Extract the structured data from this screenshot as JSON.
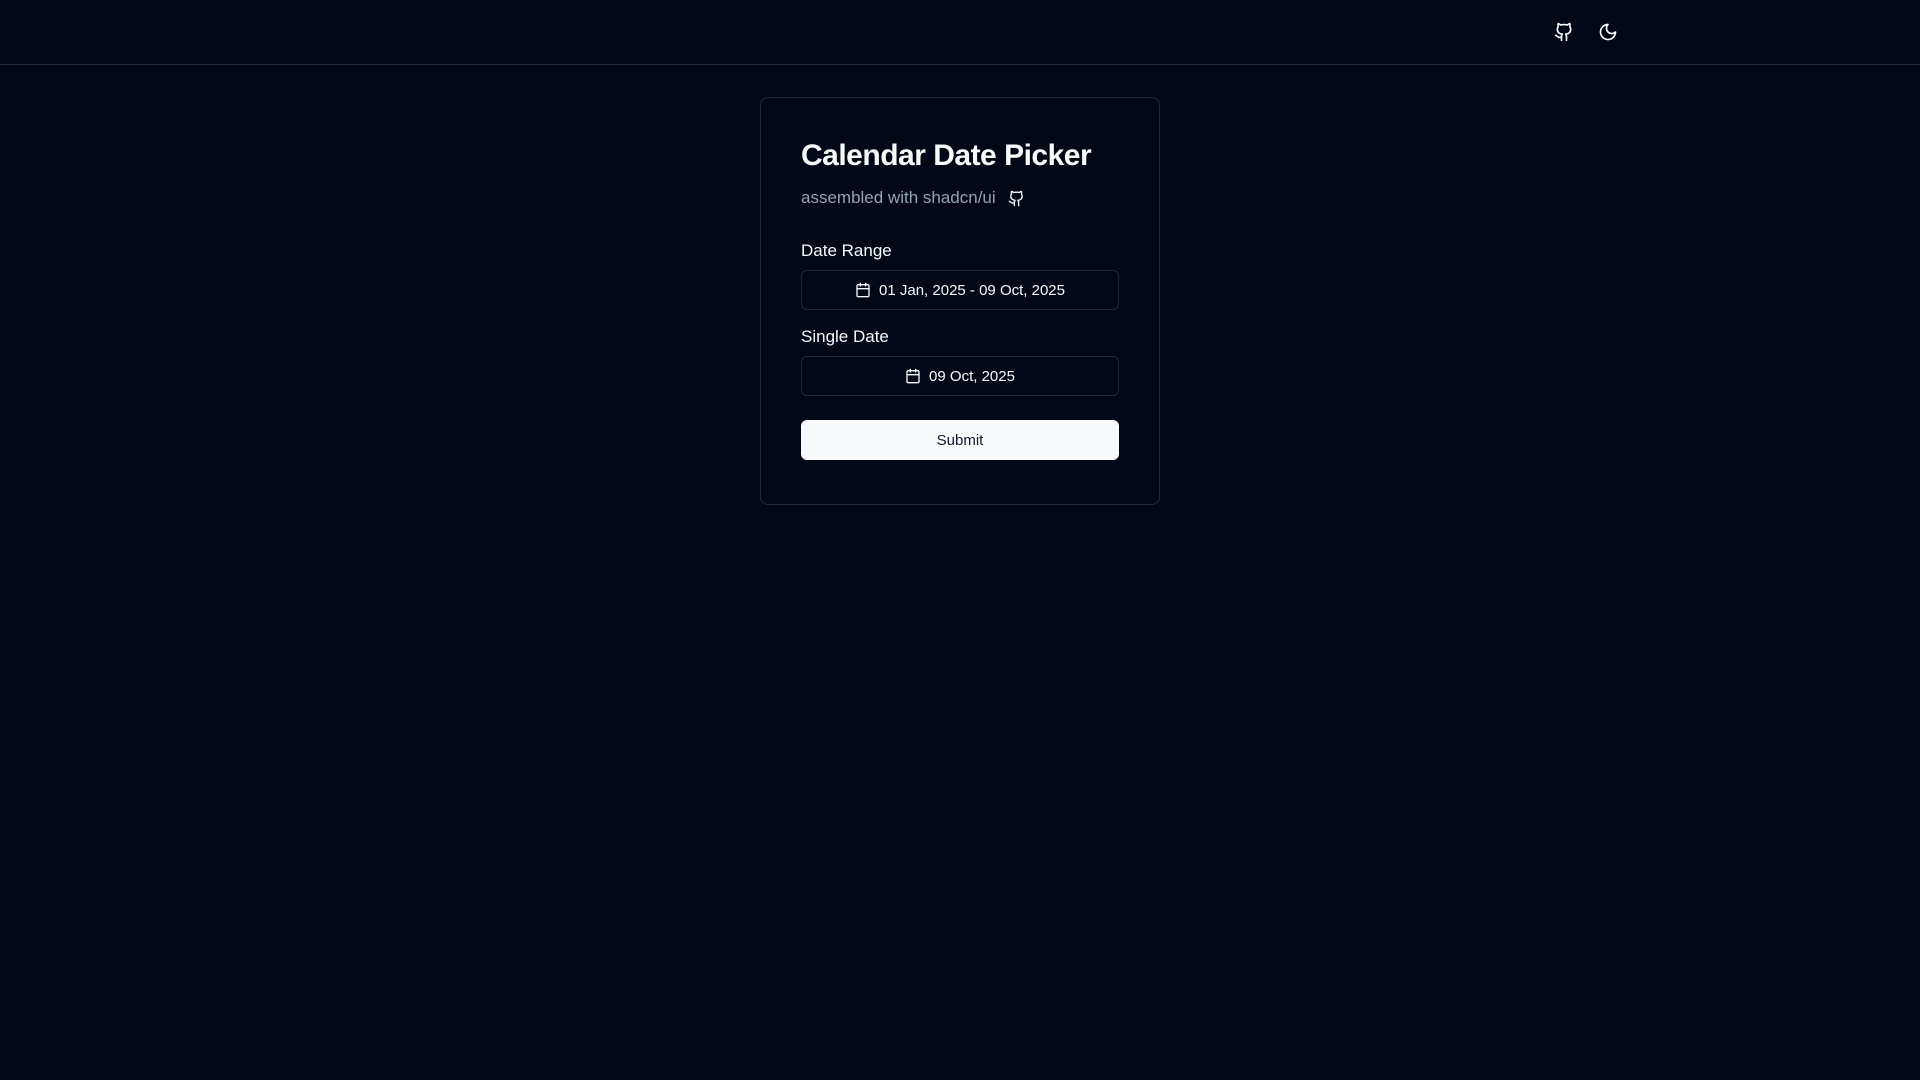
{
  "header": {
    "github_icon": "github-icon",
    "theme_icon": "moon-icon"
  },
  "card": {
    "title": "Calendar Date Picker",
    "subtitle": "assembled with shadcn/ui",
    "subtitle_icon": "github-icon"
  },
  "form": {
    "date_range": {
      "label": "Date Range",
      "value": "01 Jan, 2025 - 09 Oct, 2025",
      "icon": "calendar-icon"
    },
    "single_date": {
      "label": "Single Date",
      "value": "09 Oct, 2025",
      "icon": "calendar-icon"
    },
    "submit_label": "Submit"
  },
  "colors": {
    "background": "#020817",
    "border": "#1e293b",
    "text": "#f8fafc",
    "muted_text": "#94a3b8",
    "primary_button": "#f8fafc"
  }
}
